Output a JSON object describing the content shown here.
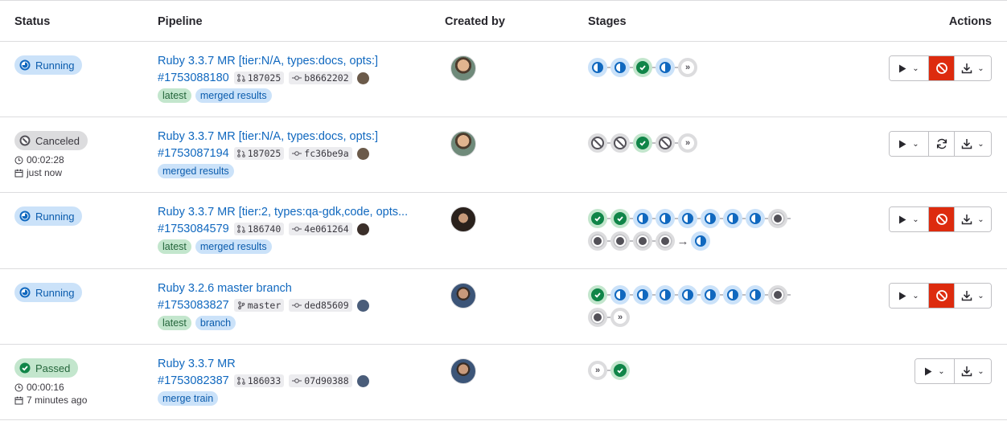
{
  "headers": {
    "status": "Status",
    "pipeline": "Pipeline",
    "created_by": "Created by",
    "stages": "Stages",
    "actions": "Actions"
  },
  "rows": [
    {
      "status": "Running",
      "title": "Ruby 3.3.7 MR [tier:N/A, types:docs, opts:]",
      "id": "#1753088180",
      "ref": "187025",
      "sha": "b8662202",
      "tags": [
        "latest",
        "merged results"
      ]
    },
    {
      "status": "Canceled",
      "duration": "00:02:28",
      "finished": "just now",
      "title": "Ruby 3.3.7 MR [tier:N/A, types:docs, opts:]",
      "id": "#1753087194",
      "ref": "187025",
      "sha": "fc36be9a",
      "tags": [
        "merged results"
      ]
    },
    {
      "status": "Running",
      "title": "Ruby 3.3.7 MR [tier:2, types:qa-gdk,code, opts...",
      "id": "#1753084579",
      "ref": "186740",
      "sha": "4e061264",
      "tags": [
        "latest",
        "merged results"
      ]
    },
    {
      "status": "Running",
      "title": "Ruby 3.2.6 master branch",
      "id": "#1753083827",
      "ref": "master",
      "sha": "ded85609",
      "tags": [
        "latest",
        "branch"
      ]
    },
    {
      "status": "Passed",
      "duration": "00:00:16",
      "finished": "7 minutes ago",
      "title": "Ruby 3.3.7 MR",
      "id": "#1753082387",
      "ref": "186033",
      "sha": "07d90388",
      "tags": [
        "merge train"
      ]
    }
  ],
  "icons": {
    "status_running": "status-running-icon",
    "status_canceled": "status-canceled-icon",
    "status_success": "status-success-icon",
    "merge_request": "merge-request-icon",
    "branch": "branch-icon",
    "commit": "commit-icon",
    "clock": "clock-icon",
    "calendar": "calendar-icon",
    "play": "play-icon",
    "cancel": "cancel-icon",
    "retry": "retry-icon",
    "download": "download-icon",
    "chevron": "chevron-down-icon"
  },
  "colors": {
    "link": "#1068bf",
    "running": "#1068bf",
    "success": "#108548",
    "danger": "#dd2b0e",
    "neutral": "#535158"
  }
}
